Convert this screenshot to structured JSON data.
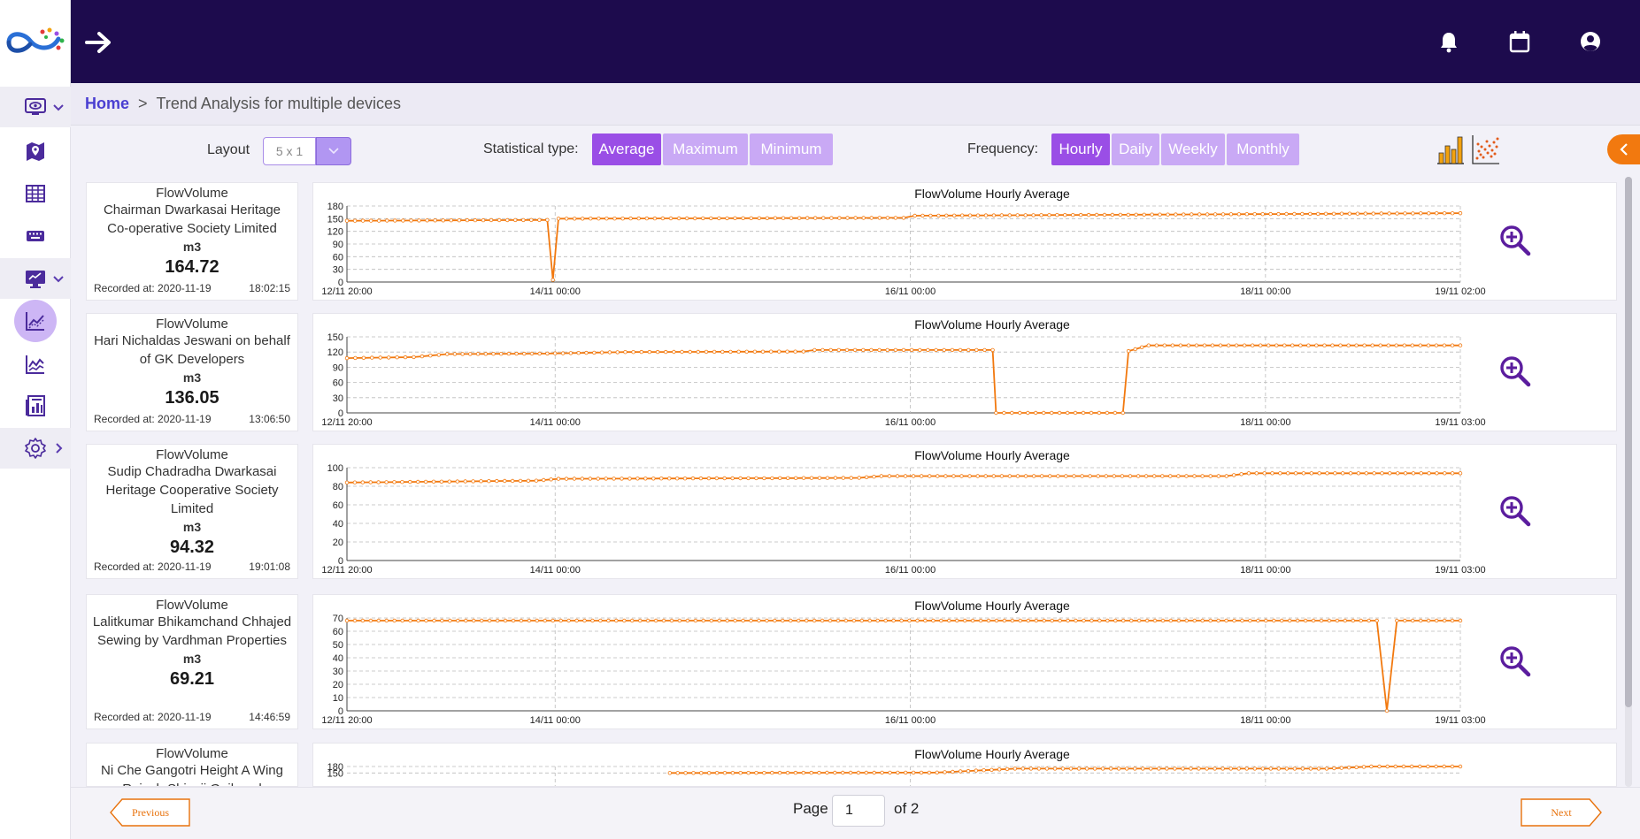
{
  "header": {
    "icons": [
      "arrow-right-icon",
      "bell-icon",
      "calendar-icon",
      "account-circle-icon"
    ]
  },
  "sidebar": {
    "icons": [
      "monitor-eye-icon",
      "map-marker-icon",
      "table-icon",
      "keyboard-icon",
      "desktop-icon",
      "trend-chart-icon",
      "line-chart-icon",
      "report-icon",
      "settings-icon"
    ]
  },
  "breadcrumb": {
    "home": "Home",
    "separator": ">",
    "current": "Trend Analysis for multiple devices"
  },
  "controls": {
    "layout_label": "Layout",
    "layout_value": "5 x 1",
    "stat_label": "Statistical type:",
    "stat_options": [
      "Average",
      "Maximum",
      "Minimum"
    ],
    "stat_selected": "Average",
    "freq_label": "Frequency:",
    "freq_options": [
      "Hourly",
      "Daily",
      "Weekly",
      "Monthly"
    ],
    "freq_selected": "Hourly"
  },
  "colors": {
    "accent": "#9a4ee6",
    "header_bg": "#1d0b4d",
    "series": "#f2790f",
    "active_nav": "#cdb6f5"
  },
  "devices": [
    {
      "parameter": "FlowVolume",
      "name": "Chairman Dwarkasai Heritage Co-operative Society Limited",
      "unit": "m3",
      "value": "164.72",
      "recorded_label": "Recorded at: 2020-11-19",
      "recorded_time": "18:02:15",
      "chart_title": "FlowVolume Hourly Average",
      "y_ticks": [
        "180",
        "150",
        "120",
        "90",
        "60",
        "30",
        "0"
      ],
      "x_ticks": [
        "12/11 20:00",
        "14/11 00:00",
        "16/11 00:00",
        "18/11 00:00",
        "19/11 02:00"
      ]
    },
    {
      "parameter": "FlowVolume",
      "name": "Hari Nichaldas Jeswani on behalf of GK Developers",
      "unit": "m3",
      "value": "136.05",
      "recorded_label": "Recorded at: 2020-11-19",
      "recorded_time": "13:06:50",
      "chart_title": "FlowVolume Hourly Average",
      "y_ticks": [
        "150",
        "120",
        "90",
        "60",
        "30",
        "0"
      ],
      "x_ticks": [
        "12/11 20:00",
        "14/11 00:00",
        "16/11 00:00",
        "18/11 00:00",
        "19/11 03:00"
      ]
    },
    {
      "parameter": "FlowVolume",
      "name": "Sudip Chadradha Dwarkasai Heritage Cooperative Society Limited",
      "unit": "m3",
      "value": "94.32",
      "recorded_label": "Recorded at: 2020-11-19",
      "recorded_time": "19:01:08",
      "chart_title": "FlowVolume Hourly Average",
      "y_ticks": [
        "100",
        "80",
        "60",
        "40",
        "20",
        "0"
      ],
      "x_ticks": [
        "12/11 20:00",
        "14/11 00:00",
        "16/11 00:00",
        "18/11 00:00",
        "19/11 03:00"
      ]
    },
    {
      "parameter": "FlowVolume",
      "name": "Lalitkumar Bhikamchand Chhajed Sewing by Vardhman Properties",
      "unit": "m3",
      "value": "69.21",
      "recorded_label": "Recorded at: 2020-11-19",
      "recorded_time": "14:46:59",
      "chart_title": "FlowVolume Hourly Average",
      "y_ticks": [
        "70",
        "60",
        "50",
        "40",
        "30",
        "20",
        "10",
        "0"
      ],
      "x_ticks": [
        "12/11 20:00",
        "14/11 00:00",
        "16/11 00:00",
        "18/11 00:00",
        "19/11 03:00"
      ]
    },
    {
      "parameter": "FlowVolume",
      "name": "Ni Che Gangotri Height A Wing Rajesh Shivaji Gaikwad",
      "unit": "",
      "value": "",
      "recorded_label": "",
      "recorded_time": "",
      "chart_title": "FlowVolume Hourly Average",
      "y_ticks": [
        "180",
        "150"
      ],
      "x_ticks": []
    }
  ],
  "chart_data": [
    {
      "type": "line",
      "title": "FlowVolume Hourly Average",
      "ylim": [
        0,
        180
      ],
      "series": [
        {
          "values": [
            [
              0,
              145
            ],
            [
              0.18,
              147
            ],
            [
              0.185,
              5
            ],
            [
              0.19,
              150
            ],
            [
              0.5,
              152
            ],
            [
              0.51,
              157
            ],
            [
              1.0,
              163
            ]
          ]
        }
      ]
    },
    {
      "type": "line",
      "title": "FlowVolume Hourly Average",
      "ylim": [
        0,
        150
      ],
      "series": [
        {
          "values": [
            [
              0,
              108
            ],
            [
              0.06,
              110
            ],
            [
              0.09,
              116
            ],
            [
              0.18,
              117
            ],
            [
              0.25,
              120
            ],
            [
              0.41,
              121
            ],
            [
              0.42,
              124
            ],
            [
              0.58,
              124
            ],
            [
              0.583,
              0
            ],
            [
              0.697,
              0
            ],
            [
              0.702,
              122
            ],
            [
              0.72,
              133
            ],
            [
              1.0,
              133
            ]
          ]
        }
      ]
    },
    {
      "type": "line",
      "title": "FlowVolume Hourly Average",
      "ylim": [
        0,
        100
      ],
      "series": [
        {
          "values": [
            [
              0,
              84
            ],
            [
              0.17,
              86
            ],
            [
              0.19,
              88
            ],
            [
              0.46,
              89
            ],
            [
              0.48,
              91
            ],
            [
              0.79,
              91
            ],
            [
              0.81,
              94
            ],
            [
              1.0,
              94
            ]
          ]
        }
      ]
    },
    {
      "type": "line",
      "title": "FlowVolume Hourly Average",
      "ylim": [
        0,
        70
      ],
      "series": [
        {
          "values": [
            [
              0,
              68
            ],
            [
              0.925,
              68
            ],
            [
              0.934,
              0
            ],
            [
              0.943,
              68
            ],
            [
              1.0,
              68
            ]
          ]
        }
      ]
    },
    {
      "type": "line",
      "title": "FlowVolume Hourly Average",
      "ylim": [
        0,
        180
      ],
      "series": [
        {
          "values": [
            [
              0.29,
              150
            ],
            [
              0.53,
              152
            ],
            [
              0.6,
              170
            ],
            [
              0.88,
              170
            ],
            [
              0.92,
              180
            ],
            [
              1.0,
              180
            ]
          ]
        }
      ]
    }
  ],
  "pagination": {
    "prev_label": "Previous",
    "next_label": "Next",
    "page_label": "Page",
    "page_value": "1",
    "of_label": "of 2"
  }
}
